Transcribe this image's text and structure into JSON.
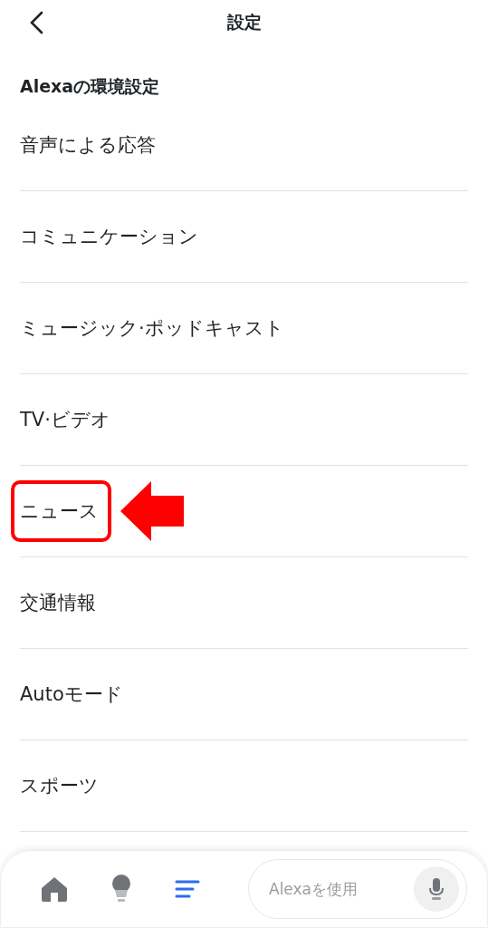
{
  "header": {
    "title": "設定"
  },
  "section": {
    "heading": "Alexaの環境設定"
  },
  "items": [
    {
      "label": "音声による応答",
      "highlighted": false
    },
    {
      "label": "コミュニケーション",
      "highlighted": false
    },
    {
      "label": "ミュージック·ポッドキャスト",
      "highlighted": false
    },
    {
      "label": "TV·ビデオ",
      "highlighted": false
    },
    {
      "label": "ニュース",
      "highlighted": true
    },
    {
      "label": "交通情報",
      "highlighted": false
    },
    {
      "label": "Autoモード",
      "highlighted": false
    },
    {
      "label": "スポーツ",
      "highlighted": false
    }
  ],
  "tab_bar": {
    "tabs": [
      {
        "kind": "home",
        "selected": false
      },
      {
        "kind": "devices",
        "selected": false
      },
      {
        "kind": "more",
        "selected": true
      }
    ],
    "search": {
      "placeholder": "Alexaを使用"
    }
  }
}
